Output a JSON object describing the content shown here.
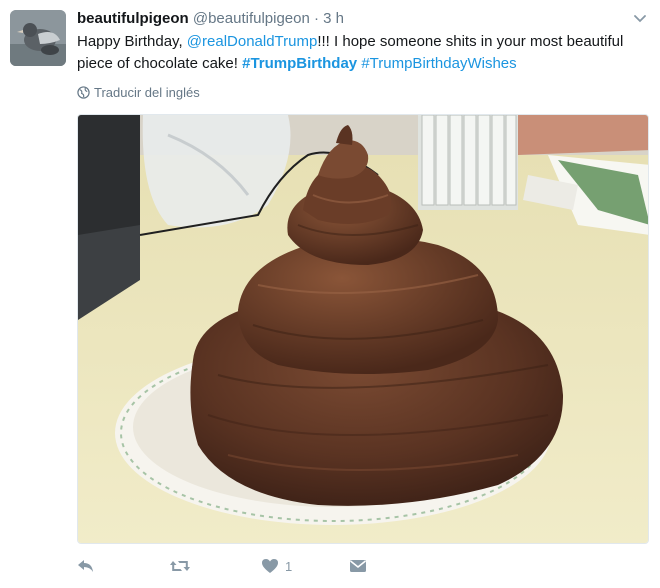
{
  "tweet": {
    "display_name": "beautifulpigeon",
    "handle": "@beautifulpigeon",
    "separator": "·",
    "time": "3 h",
    "text_intro": "Happy Birthday, ",
    "mention": "@realDonaldTrump",
    "text_body": "!!! I hope someone shits in your most beautiful piece of chocolate cake! ",
    "hashtag_1": "#TrumpBirthday",
    "hashtag_2": "#TrumpBirthdayWishes",
    "translate_label": "Traducir del inglés"
  },
  "actions": {
    "reply_icon": "reply-icon",
    "retweet_icon": "retweet-icon",
    "like_icon": "heart-icon",
    "like_count": "1",
    "dm_icon": "envelope-icon"
  },
  "colors": {
    "link": "#1b95e0",
    "muted": "#657786",
    "icon": "#8899a6"
  }
}
